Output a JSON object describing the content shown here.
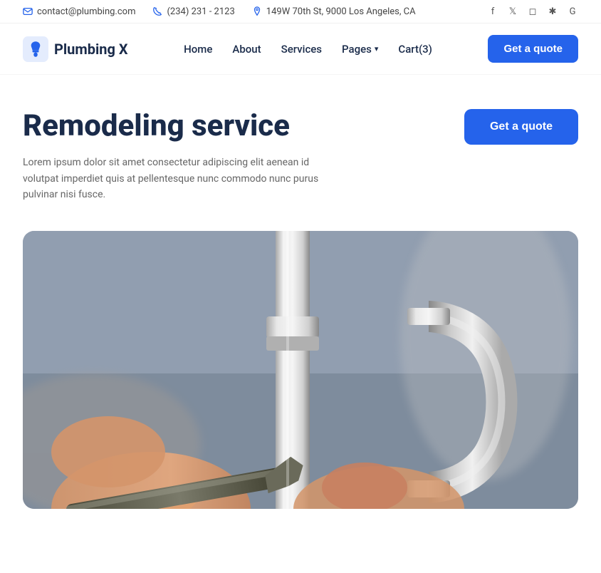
{
  "topbar": {
    "email": "contact@plumbing.com",
    "phone": "(234) 231 - 2123",
    "address": "149W 70th St, 9000 Los Angeles, CA",
    "social": [
      {
        "name": "facebook",
        "symbol": "f"
      },
      {
        "name": "twitter",
        "symbol": "t"
      },
      {
        "name": "instagram",
        "symbol": "in"
      },
      {
        "name": "yelp",
        "symbol": "★"
      },
      {
        "name": "google",
        "symbol": "G"
      }
    ]
  },
  "header": {
    "logo_text": "Plumbing X",
    "nav": [
      {
        "label": "Home",
        "id": "home"
      },
      {
        "label": "About",
        "id": "about"
      },
      {
        "label": "Services",
        "id": "services"
      },
      {
        "label": "Pages",
        "id": "pages"
      },
      {
        "label": "Cart(3)",
        "id": "cart"
      }
    ],
    "cta_label": "Get a quote"
  },
  "hero": {
    "title": "Remodeling service",
    "description": "Lorem ipsum dolor sit amet consectetur adipiscing elit aenean id volutpat imperdiet quis at pellentesque nunc commodo nunc purus pulvinar nisi fusce.",
    "cta_label": "Get a quote"
  },
  "image": {
    "alt": "Plumber working on pipes with wrench"
  },
  "colors": {
    "primary_blue": "#2563eb",
    "dark_navy": "#1a2b4a",
    "text_gray": "#666666"
  }
}
